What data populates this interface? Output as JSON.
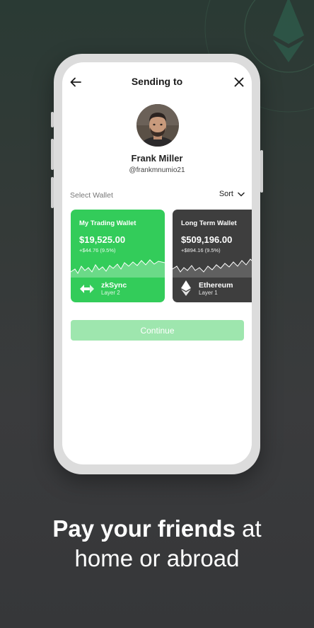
{
  "header": {
    "title": "Sending to"
  },
  "recipient": {
    "name": "Frank Miller",
    "handle": "@frankmnumio21"
  },
  "wallet_section": {
    "label": "Select Wallet",
    "sort_label": "Sort"
  },
  "wallets": [
    {
      "title": "My Trading Wallet",
      "balance": "$19,525.00",
      "change": "+$44.76 (9.5%)",
      "network": "zkSync",
      "layer": "Layer 2",
      "color": "#33cc5a",
      "icon": "zksync-icon"
    },
    {
      "title": "Long Term Wallet",
      "balance": "$509,196.00",
      "change": "+$894.16 (9.5%)",
      "network": "Ethereum",
      "layer": "Layer 1",
      "color": "#3e3e3e",
      "icon": "ethereum-icon"
    }
  ],
  "continue_label": "Continue",
  "tagline": {
    "bold": "Pay your friends",
    "line1_rest": " at",
    "line2": "home or abroad"
  },
  "colors": {
    "accent": "#33cc5a",
    "button_disabled": "#9ee6ae"
  }
}
